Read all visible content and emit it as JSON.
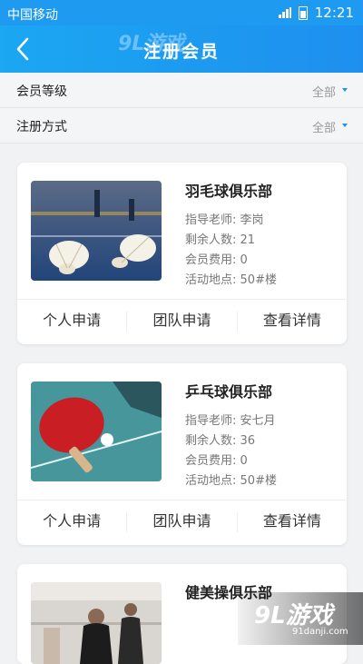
{
  "status_bar": {
    "carrier": "中国移动",
    "time": "12:21"
  },
  "header": {
    "title": "注册会员",
    "watermark": "9L游戏"
  },
  "filters": [
    {
      "label": "会员等级",
      "value": "全部"
    },
    {
      "label": "注册方式",
      "value": "全部"
    }
  ],
  "clubs": [
    {
      "name": "羽毛球俱乐部",
      "image": "badminton-shuttlecock-photo",
      "teacher_label": "指导老师:",
      "teacher": "李岗",
      "remaining_label": "剩余人数:",
      "remaining": "21",
      "fee_label": "会员费用:",
      "fee": "0",
      "location_label": "活动地点:",
      "location": "50#楼",
      "actions": [
        "个人申请",
        "团队申请",
        "查看详情"
      ]
    },
    {
      "name": "乒乓球俱乐部",
      "image": "table-tennis-paddle-photo",
      "teacher_label": "指导老师:",
      "teacher": "安七月",
      "remaining_label": "剩余人数:",
      "remaining": "36",
      "fee_label": "会员费用:",
      "fee": "0",
      "location_label": "活动地点:",
      "location": "50#楼",
      "actions": [
        "个人申请",
        "团队申请",
        "查看详情"
      ]
    },
    {
      "name": "健美操俱乐部",
      "image": "aerobics-class-photo"
    }
  ],
  "watermark": {
    "logo": "9L游戏",
    "url": "91danji.com"
  }
}
